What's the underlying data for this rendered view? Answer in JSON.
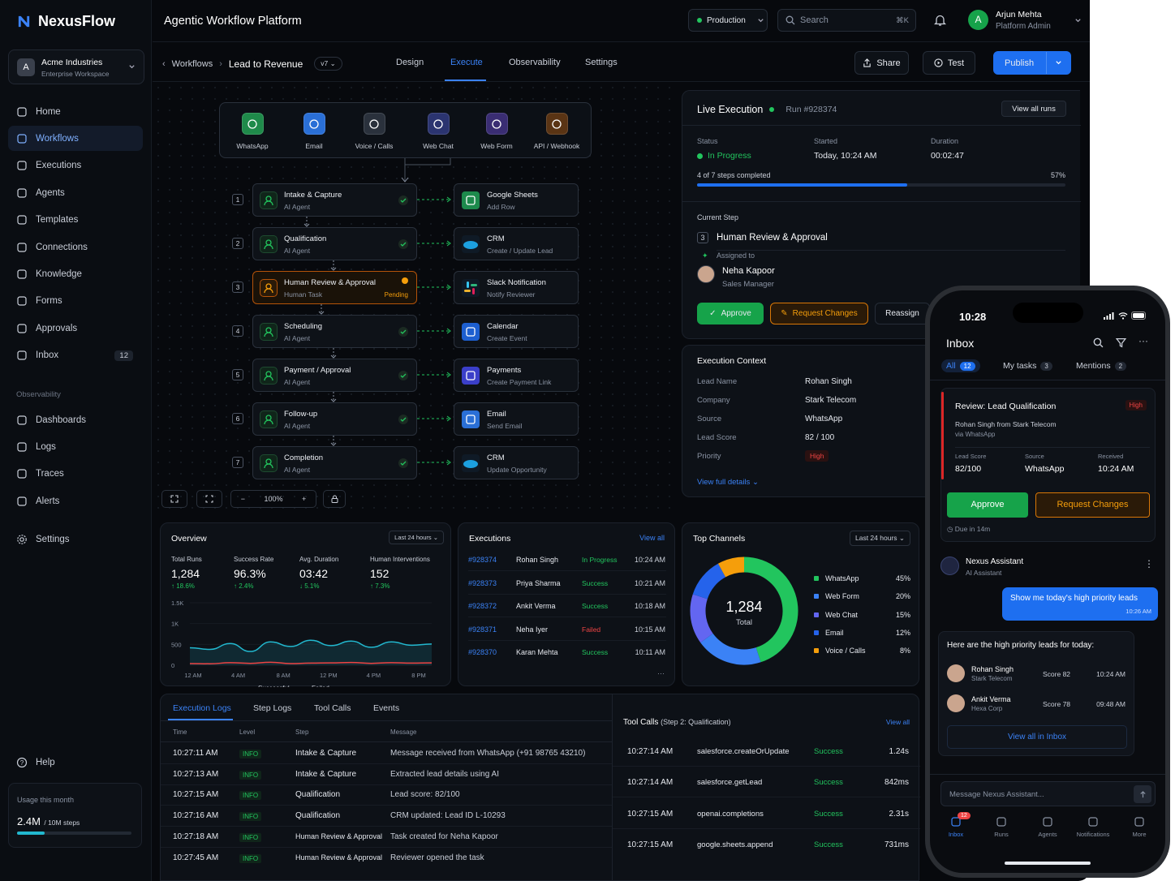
{
  "brand": {
    "name": "NexusFlow"
  },
  "workspace": {
    "name": "Acme Industries",
    "type": "Enterprise Workspace",
    "initial": "A"
  },
  "nav": {
    "main": [
      {
        "label": "Home",
        "icon": "home-icon"
      },
      {
        "label": "Workflows",
        "icon": "workflow-icon",
        "active": true
      },
      {
        "label": "Executions",
        "icon": "executions-icon"
      },
      {
        "label": "Agents",
        "icon": "agents-icon"
      },
      {
        "label": "Templates",
        "icon": "templates-icon"
      },
      {
        "label": "Connections",
        "icon": "link-icon"
      },
      {
        "label": "Knowledge",
        "icon": "book-icon"
      },
      {
        "label": "Forms",
        "icon": "form-icon"
      },
      {
        "label": "Approvals",
        "icon": "check-circle-icon"
      },
      {
        "label": "Inbox",
        "icon": "inbox-icon",
        "badge": "12"
      }
    ],
    "section_label": "Observability",
    "observability": [
      {
        "label": "Dashboards",
        "icon": "dashboard-icon"
      },
      {
        "label": "Logs",
        "icon": "logs-icon"
      },
      {
        "label": "Traces",
        "icon": "traces-icon"
      },
      {
        "label": "Alerts",
        "icon": "bell-icon"
      }
    ],
    "settings": "Settings",
    "help": "Help"
  },
  "usage": {
    "label": "Usage this month",
    "value": "2.4M",
    "total": "/ 10M steps",
    "fraction": 0.24
  },
  "topbar": {
    "title": "Agentic Workflow Platform",
    "env": "Production",
    "search_placeholder": "Search",
    "shortcut": "⌘K",
    "user_name": "Arjun Mehta",
    "user_role": "Platform Admin",
    "user_initial": "A"
  },
  "subnav": {
    "crumb_parent": "Workflows",
    "crumb_current": "Lead to Revenue",
    "version": "v7",
    "tabs": [
      "Design",
      "Execute",
      "Observability",
      "Settings"
    ],
    "active_tab": "Execute",
    "share": "Share",
    "test": "Test",
    "publish": "Publish"
  },
  "channels": [
    {
      "label": "WhatsApp",
      "color": "#1f8a4a",
      "icon": "whatsapp-icon"
    },
    {
      "label": "Email",
      "color": "#2a6fd6",
      "icon": "mail-icon"
    },
    {
      "label": "Voice / Calls",
      "color": "#2a313c",
      "icon": "phone-icon"
    },
    {
      "label": "Web Chat",
      "color": "#2b3470",
      "icon": "chat-icon"
    },
    {
      "label": "Web Form",
      "color": "#3a2d73",
      "icon": "form-icon"
    },
    {
      "label": "API / Webhook",
      "color": "#5a3414",
      "icon": "webhook-icon"
    }
  ],
  "steps": [
    {
      "n": "1",
      "title": "Intake & Capture",
      "sub": "AI Agent",
      "status": "done"
    },
    {
      "n": "2",
      "title": "Qualification",
      "sub": "AI Agent",
      "status": "done"
    },
    {
      "n": "3",
      "title": "Human Review & Approval",
      "sub": "Human Task",
      "status": "pending",
      "status_label": "Pending"
    },
    {
      "n": "4",
      "title": "Scheduling",
      "sub": "AI Agent",
      "status": "done"
    },
    {
      "n": "5",
      "title": "Payment / Approval",
      "sub": "AI Agent",
      "status": "done"
    },
    {
      "n": "6",
      "title": "Follow-up",
      "sub": "AI Agent",
      "status": "done"
    },
    {
      "n": "7",
      "title": "Completion",
      "sub": "AI Agent",
      "status": "done"
    }
  ],
  "actions": [
    {
      "title": "Google Sheets",
      "sub": "Add Row",
      "color": "#1d8a4c",
      "icon": "sheets-icon"
    },
    {
      "title": "CRM",
      "sub": "Create / Update Lead",
      "color": "#0f1a26",
      "icon": "salesforce-cloud-icon"
    },
    {
      "title": "Slack Notification",
      "sub": "Notify Reviewer",
      "color": "#0f1a26",
      "icon": "slack-icon"
    },
    {
      "title": "Calendar",
      "sub": "Create Event",
      "color": "#1d5fd0",
      "icon": "calendar-icon"
    },
    {
      "title": "Payments",
      "sub": "Create Payment Link",
      "color": "#3b3fc9",
      "icon": "stripe-icon"
    },
    {
      "title": "Email",
      "sub": "Send Email",
      "color": "#2a6fd6",
      "icon": "mail-icon"
    },
    {
      "title": "CRM",
      "sub": "Update Opportunity",
      "color": "#0f1a26",
      "icon": "salesforce-cloud-icon"
    }
  ],
  "canvas_tools": {
    "zoom": "100%"
  },
  "live": {
    "title": "Live Execution",
    "run": "Run #928374",
    "view_all": "View all runs",
    "status_label": "Status",
    "status": "In Progress",
    "started_label": "Started",
    "started": "Today, 10:24 AM",
    "duration_label": "Duration",
    "duration": "00:02:47",
    "progress_text": "4 of 7 steps completed",
    "progress_pct": "57%",
    "progress": 0.57,
    "current_label": "Current Step",
    "current_n": "3",
    "current_step": "Human Review & Approval",
    "assigned_label": "Assigned to",
    "assignee": "Neha Kapoor",
    "assignee_role": "Sales Manager",
    "approve": "Approve",
    "request_changes": "Request Changes",
    "reassign": "Reassign"
  },
  "context": {
    "title": "Execution Context",
    "rows": [
      {
        "k": "Lead Name",
        "v": "Rohan Singh"
      },
      {
        "k": "Company",
        "v": "Stark Telecom"
      },
      {
        "k": "Source",
        "v": "WhatsApp"
      },
      {
        "k": "Lead Score",
        "v": "82 / 100"
      },
      {
        "k": "Priority",
        "v": "High"
      }
    ],
    "link": "View full details"
  },
  "overview": {
    "title": "Overview",
    "range": "Last 24 hours",
    "kpis": [
      {
        "label": "Total Runs",
        "value": "1,284",
        "delta": "↑ 18.6%"
      },
      {
        "label": "Success Rate",
        "value": "96.3%",
        "delta": "↑ 2.4%"
      },
      {
        "label": "Avg. Duration",
        "value": "03:42",
        "delta": "↓ 5.1%"
      },
      {
        "label": "Human Interventions",
        "value": "152",
        "delta": "↑ 7.3%"
      }
    ],
    "legend_success": "Successful",
    "legend_failed": "Failed"
  },
  "chart_data": {
    "type": "area",
    "x": [
      "12 AM",
      "4 AM",
      "8 AM",
      "12 PM",
      "4 PM",
      "8 PM"
    ],
    "y_ticks": [
      "1.5K",
      "1K",
      "500",
      "0"
    ],
    "ylim": [
      0,
      1500
    ],
    "series": [
      {
        "name": "Successful",
        "values": [
          420,
          380,
          520,
          330,
          560,
          450,
          600,
          470,
          580,
          430,
          560,
          480,
          510
        ]
      },
      {
        "name": "Failed",
        "values": [
          40,
          35,
          60,
          45,
          70,
          40,
          50,
          55,
          65,
          45,
          60,
          50,
          55
        ]
      }
    ]
  },
  "executions": {
    "title": "Executions",
    "view_all": "View all",
    "rows": [
      {
        "id": "#928374",
        "name": "Rohan Singh",
        "status": "In Progress",
        "time": "10:24 AM",
        "tone": "progress"
      },
      {
        "id": "#928373",
        "name": "Priya Sharma",
        "status": "Success",
        "time": "10:21 AM",
        "tone": "success"
      },
      {
        "id": "#928372",
        "name": "Ankit Verma",
        "status": "Success",
        "time": "10:18 AM",
        "tone": "success"
      },
      {
        "id": "#928371",
        "name": "Neha Iyer",
        "status": "Failed",
        "time": "10:15 AM",
        "tone": "failed"
      },
      {
        "id": "#928370",
        "name": "Karan Mehta",
        "status": "Success",
        "time": "10:11 AM",
        "tone": "success"
      }
    ]
  },
  "top_channels": {
    "title": "Top Channels",
    "range": "Last 24 hours",
    "total": "1,284",
    "total_label": "Total",
    "items": [
      {
        "label": "WhatsApp",
        "pct": "45%",
        "value": 45,
        "color": "#22c55e"
      },
      {
        "label": "Web Form",
        "pct": "20%",
        "value": 20,
        "color": "#3b82f6"
      },
      {
        "label": "Web Chat",
        "pct": "15%",
        "value": 15,
        "color": "#6366f1"
      },
      {
        "label": "Email",
        "pct": "12%",
        "value": 12,
        "color": "#2563eb"
      },
      {
        "label": "Voice / Calls",
        "pct": "8%",
        "value": 8,
        "color": "#f59e0b"
      }
    ]
  },
  "logs": {
    "tabs": [
      "Execution Logs",
      "Step Logs",
      "Tool Calls",
      "Events"
    ],
    "headers": [
      "Time",
      "Level",
      "Step",
      "Message"
    ],
    "rows": [
      {
        "time": "10:27:11 AM",
        "level": "INFO",
        "step": "Intake & Capture",
        "msg": "Message received from WhatsApp (+91 98765 43210)"
      },
      {
        "time": "10:27:13 AM",
        "level": "INFO",
        "step": "Intake & Capture",
        "msg": "Extracted lead details using AI"
      },
      {
        "time": "10:27:15 AM",
        "level": "INFO",
        "step": "Qualification",
        "msg": "Lead score: 82/100"
      },
      {
        "time": "10:27:16 AM",
        "level": "INFO",
        "step": "Qualification",
        "msg": "CRM updated: Lead ID L-10293"
      },
      {
        "time": "10:27:18 AM",
        "level": "INFO",
        "step": "Human Review & Approval",
        "msg": "Task created for Neha Kapoor"
      },
      {
        "time": "10:27:45 AM",
        "level": "INFO",
        "step": "Human Review & Approval",
        "msg": "Reviewer opened the task"
      }
    ]
  },
  "tool_calls": {
    "title": "Tool Calls",
    "sub": "(Step 2: Qualification)",
    "view_all": "View all",
    "rows": [
      {
        "time": "10:27:14 AM",
        "call": "salesforce.createOrUpdate",
        "status": "Success",
        "dur": "1.24s"
      },
      {
        "time": "10:27:14 AM",
        "call": "salesforce.getLead",
        "status": "Success",
        "dur": "842ms"
      },
      {
        "time": "10:27:15 AM",
        "call": "openai.completions",
        "status": "Success",
        "dur": "2.31s"
      },
      {
        "time": "10:27:15 AM",
        "call": "google.sheets.append",
        "status": "Success",
        "dur": "731ms"
      }
    ]
  },
  "mobile": {
    "time": "10:28",
    "title": "Inbox",
    "tabs": [
      {
        "label": "All",
        "count": "12"
      },
      {
        "label": "My tasks",
        "count": "3"
      },
      {
        "label": "Mentions",
        "count": "2"
      }
    ],
    "card": {
      "title": "Review: Lead Qualification",
      "priority": "High",
      "desc": "Rohan Singh from Stark Telecom",
      "via": "via WhatsApp",
      "score_label": "Lead Score",
      "score": "82/100",
      "source_label": "Source",
      "source": "WhatsApp",
      "received_label": "Received",
      "received": "10:24 AM",
      "approve": "Approve",
      "request": "Request Changes",
      "due": "Due in 14m"
    },
    "assistant": {
      "name": "Nexus Assistant",
      "role": "AI Assistant",
      "user_msg": "Show me today's high priority leads",
      "user_time": "10:26 AM",
      "reply": "Here are the high priority leads for today:",
      "leads": [
        {
          "name": "Rohan Singh",
          "co": "Stark Telecom",
          "score": "Score 82",
          "time": "10:24 AM"
        },
        {
          "name": "Ankit Verma",
          "co": "Hexa Corp",
          "score": "Score 78",
          "time": "09:48 AM"
        }
      ],
      "view_all": "View all in Inbox"
    },
    "composer_placeholder": "Message Nexus Assistant...",
    "tabbar": [
      {
        "label": "Inbox",
        "badge": "12"
      },
      {
        "label": "Runs"
      },
      {
        "label": "Agents"
      },
      {
        "label": "Notifications"
      },
      {
        "label": "More"
      }
    ]
  }
}
